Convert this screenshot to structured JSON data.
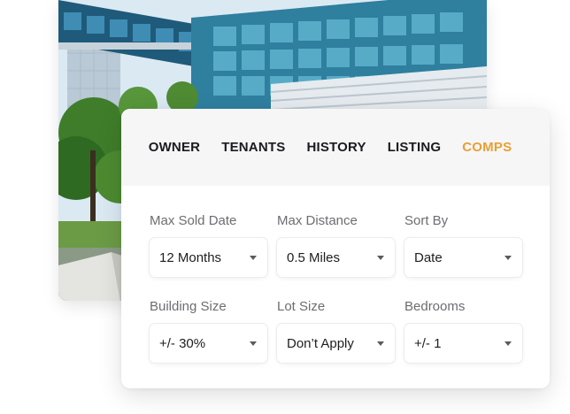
{
  "tabs": [
    {
      "label": "OWNER"
    },
    {
      "label": "TENANTS"
    },
    {
      "label": "HISTORY"
    },
    {
      "label": "LISTING"
    },
    {
      "label": "COMPS"
    }
  ],
  "active_tab": "COMPS",
  "accent_color": "#e8a033",
  "filters": [
    {
      "label": "Max Sold Date",
      "value": "12 Months"
    },
    {
      "label": "Max Distance",
      "value": "0.5 Miles"
    },
    {
      "label": "Sort By",
      "value": "Date"
    },
    {
      "label": "Building Size",
      "value": "+/- 30%"
    },
    {
      "label": "Lot Size",
      "value": "Don’t Apply"
    },
    {
      "label": "Bedrooms",
      "value": "+/- 1"
    }
  ]
}
